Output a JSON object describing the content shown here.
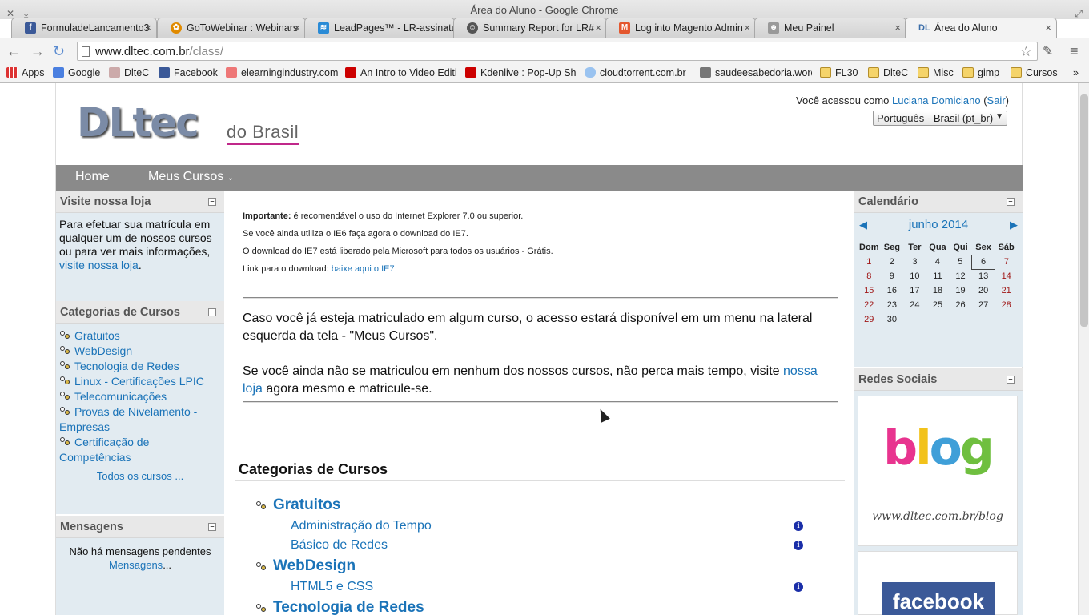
{
  "window": {
    "title": "Área do Aluno - Google Chrome"
  },
  "tabs": [
    {
      "label": "FormuladeLancamento3",
      "favicon": "facebook-icon",
      "color": "#3b5998"
    },
    {
      "label": "GoToWebinar : Webinars",
      "favicon": "gotowebinar-icon",
      "color": "#e08a00"
    },
    {
      "label": "LeadPages™ - LR-assinatu",
      "favicon": "leadpages-icon",
      "color": "#2a8bd6"
    },
    {
      "label": "Summary Report for LR#",
      "favicon": "mailchimp-icon",
      "color": "#444"
    },
    {
      "label": "Log into Magento Admin",
      "favicon": "magento-icon",
      "color": "#e4572e"
    },
    {
      "label": "Meu Painel",
      "favicon": "moodle-icon",
      "color": "#888"
    },
    {
      "label": "Área do Aluno",
      "favicon": "dl-icon",
      "color": "#3a6da8",
      "active": true
    }
  ],
  "omnibox": {
    "host": "www.dltec.com.br",
    "path": "/class/"
  },
  "bookmarks": [
    {
      "label": "Apps",
      "icon": "apps-icon"
    },
    {
      "label": "Google",
      "icon": "google-icon"
    },
    {
      "label": "DlteC",
      "icon": "dltec-icon"
    },
    {
      "label": "Facebook",
      "icon": "facebook-icon"
    },
    {
      "label": "elearningindustry.com",
      "icon": "elearning-icon"
    },
    {
      "label": "An Intro to Video Editi",
      "icon": "youtube-icon"
    },
    {
      "label": "Kdenlive : Pop-Up Sha",
      "icon": "youtube-icon"
    },
    {
      "label": "cloudtorrent.com.br",
      "icon": "cloud-icon"
    },
    {
      "label": "saudeesabedoria.word",
      "icon": "page-icon"
    },
    {
      "label": "FL30",
      "icon": "folder-icon"
    },
    {
      "label": "DlteC",
      "icon": "folder-icon"
    },
    {
      "label": "Misc",
      "icon": "folder-icon"
    },
    {
      "label": "gimp",
      "icon": "folder-icon"
    },
    {
      "label": "Cursos",
      "icon": "folder-icon"
    }
  ],
  "header": {
    "logo": "DLtec",
    "logo_sub": "do Brasil",
    "login_prefix": "Você acessou como ",
    "user_name": "Luciana Domiciano",
    "logout": "Sair",
    "language": "Português - Brasil (pt_br)"
  },
  "menu": {
    "home": "Home",
    "my_courses": "Meus Cursos"
  },
  "store_block": {
    "title": "Visite nossa loja",
    "text": "Para efetuar sua matrícula em qualquer um de nossos cursos ou para ver mais informações,",
    "link": "visite nossa loja"
  },
  "categories_block": {
    "title": "Categorias de Cursos",
    "items": [
      "Gratuitos",
      "WebDesign",
      "Tecnologia de Redes",
      "Linux - Certificações LPIC",
      "Telecomunicações",
      "Provas de Nivelamento - Empresas",
      "Certificação de Competências"
    ],
    "all_courses": "Todos os cursos ..."
  },
  "messages_block": {
    "title": "Mensagens",
    "text": "Não há mensagens pendentes",
    "link": "Mensagens"
  },
  "notice": {
    "important_label": "Importante:",
    "line1": " é recomendável o uso do Internet Explorer 7.0 ou superior.",
    "line2": "Se você ainda utiliza o IE6 faça agora o download do IE7.",
    "line3": "O download do IE7 está liberado pela Microsoft para todos os usuários - Grátis.",
    "line4_prefix": "Link para o download: ",
    "line4_link": "baixe aqui o IE7"
  },
  "intro": {
    "para1": "Caso você já esteja matriculado em algum curso, o acesso estará disponível em um menu na lateral esquerda da tela - \"Meus Cursos\".",
    "para2_prefix": "Se você ainda não se matriculou em nenhum dos nossos cursos, não perca mais tempo, visite ",
    "para2_link": "nossa loja",
    "para2_suffix": " agora mesmo e matricule-se."
  },
  "course_categories": {
    "heading": "Categorias de Cursos",
    "groups": [
      {
        "name": "Gratuitos",
        "courses": [
          "Administração do Tempo",
          "Básico de Redes"
        ]
      },
      {
        "name": "WebDesign",
        "courses": [
          "HTML5 e CSS"
        ]
      },
      {
        "name": "Tecnologia de Redes",
        "courses": []
      }
    ]
  },
  "calendar": {
    "title": "Calendário",
    "month": "junho 2014",
    "days": [
      "Dom",
      "Seg",
      "Ter",
      "Qua",
      "Qui",
      "Sex",
      "Sáb"
    ],
    "weeks": [
      [
        "1",
        "2",
        "3",
        "4",
        "5",
        "6",
        "7"
      ],
      [
        "8",
        "9",
        "10",
        "11",
        "12",
        "13",
        "14"
      ],
      [
        "15",
        "16",
        "17",
        "18",
        "19",
        "20",
        "21"
      ],
      [
        "22",
        "23",
        "24",
        "25",
        "26",
        "27",
        "28"
      ],
      [
        "29",
        "30",
        "",
        "",
        "",
        "",
        ""
      ]
    ],
    "today": "6"
  },
  "social": {
    "title": "Redes Sociais",
    "blog_text": "blog",
    "blog_url": "www.dltec.com.br/blog",
    "facebook_text": "facebook"
  }
}
